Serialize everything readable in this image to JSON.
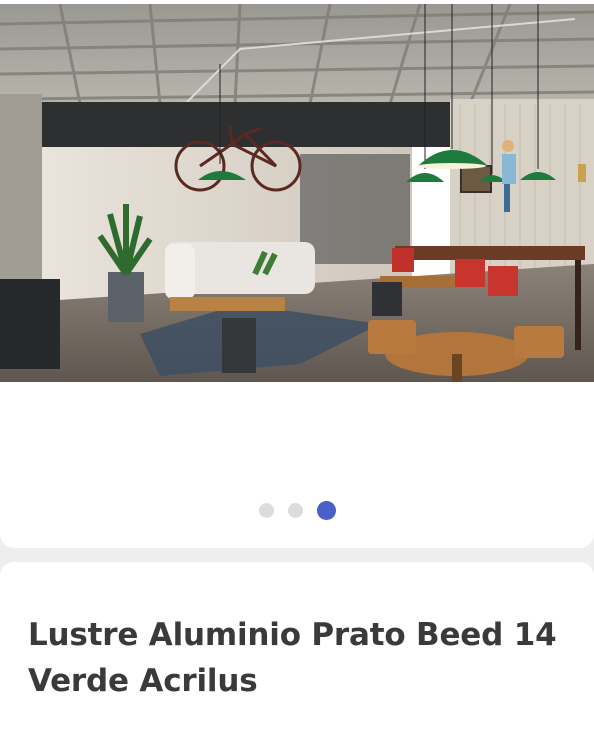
{
  "gallery": {
    "image_alt": "Cafe interior with green pendant lamps",
    "slides": [
      {
        "active": false
      },
      {
        "active": false
      },
      {
        "active": true
      }
    ],
    "colors": {
      "active_dot": "#4a5fc7",
      "inactive_dot": "#dcdcdc",
      "lamp": "#1f7a3d"
    }
  },
  "product": {
    "title": "Lustre Aluminio Prato Beed 14 Verde Acrilus"
  }
}
